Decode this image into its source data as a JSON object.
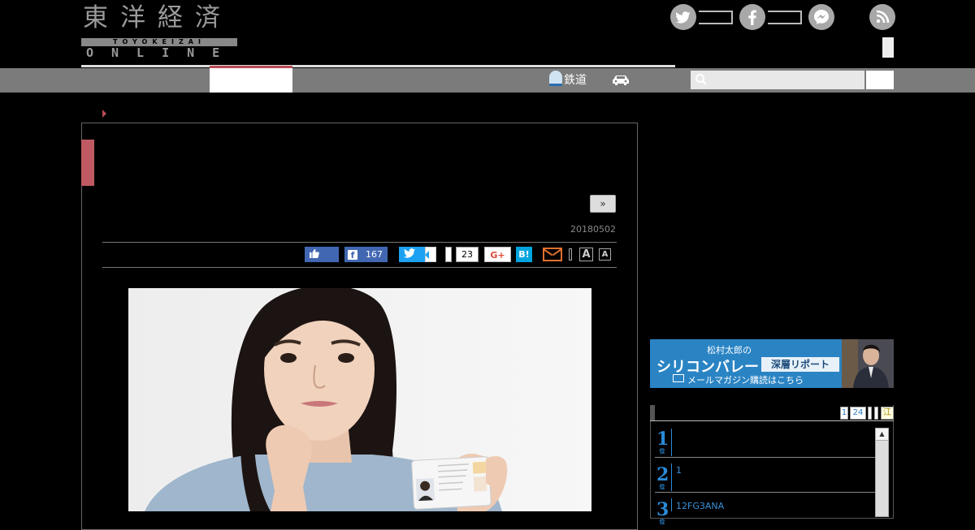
{
  "header": {
    "logo_kanji": "東洋経済",
    "logo_band": "TOYOKEIZAI",
    "logo_online": "ONLINE",
    "social": {
      "twitter_icon": "twitter-icon",
      "facebook_icon": "facebook-icon",
      "messenger_icon": "messenger-icon",
      "rss_icon": "rss-icon"
    }
  },
  "nav": {
    "rail_label": "鉄道",
    "rail_icon": "train-icon",
    "car_icon": "car-icon",
    "search_icon": "search-icon",
    "search_placeholder": ""
  },
  "article": {
    "next_label": "»",
    "date": "20180502",
    "share": {
      "facebook_count": "167",
      "tweet_count": "23",
      "gplus_label": "G+",
      "hatena_label": "B!",
      "font_large": "A",
      "font_small": "A"
    },
    "photo_icon": "woman-holding-id-card-photo"
  },
  "sidebar": {
    "banner": {
      "line1": "松村太郎の",
      "line2": "シリコンバレー",
      "line3": "深層リポート",
      "line4": "メールマガジン購読はこちら"
    },
    "ranking": {
      "tabs": [
        "1",
        "24",
        "",
        "",
        "江"
      ],
      "items": [
        {
          "rank": "1",
          "suffix": "位",
          "text": ""
        },
        {
          "rank": "2",
          "suffix": "位",
          "text": "1"
        },
        {
          "rank": "3",
          "suffix": "位",
          "text": "12FG3ANA"
        }
      ],
      "scroll_up": "▲"
    }
  },
  "colors": {
    "accent": "#b94a55",
    "nav_bg": "#7b7b7b",
    "facebook": "#4267b2",
    "twitter": "#1da1f2",
    "hatena": "#00a4de",
    "rank_blue": "#2a8ad8"
  }
}
